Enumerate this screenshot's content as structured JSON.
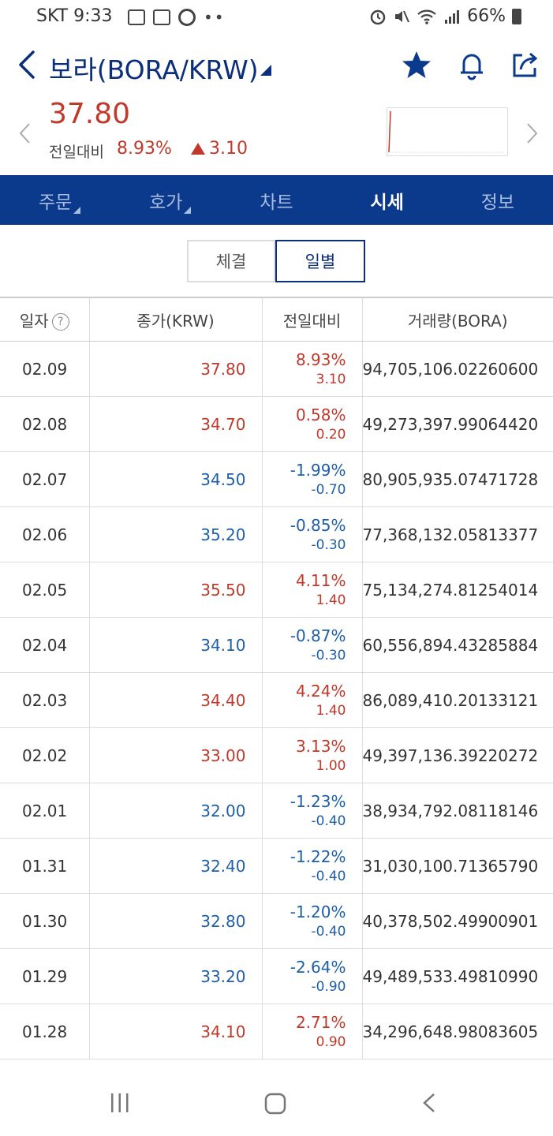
{
  "status": {
    "time": "SKT 9:33",
    "battery": "66%"
  },
  "header": {
    "title": "보라(BORA/KRW)"
  },
  "quote": {
    "price": "37.80",
    "compare_label": "전일대비",
    "change_pct": "8.93%",
    "change_abs": "3.10"
  },
  "tabs": [
    "주문",
    "호가",
    "차트",
    "시세",
    "정보"
  ],
  "segments": [
    "체결",
    "일별"
  ],
  "table": {
    "headers": [
      "일자",
      "종가(KRW)",
      "전일대비",
      "거래량(BORA)"
    ],
    "rows": [
      {
        "date": "02.09",
        "close": "37.80",
        "pct": "8.93%",
        "abs": "3.10",
        "vol": "94,705,106.02260600",
        "dir": "up"
      },
      {
        "date": "02.08",
        "close": "34.70",
        "pct": "0.58%",
        "abs": "0.20",
        "vol": "49,273,397.99064420",
        "dir": "up"
      },
      {
        "date": "02.07",
        "close": "34.50",
        "pct": "-1.99%",
        "abs": "-0.70",
        "vol": "80,905,935.07471728",
        "dir": "down"
      },
      {
        "date": "02.06",
        "close": "35.20",
        "pct": "-0.85%",
        "abs": "-0.30",
        "vol": "77,368,132.05813377",
        "dir": "down"
      },
      {
        "date": "02.05",
        "close": "35.50",
        "pct": "4.11%",
        "abs": "1.40",
        "vol": "75,134,274.81254014",
        "dir": "up"
      },
      {
        "date": "02.04",
        "close": "34.10",
        "pct": "-0.87%",
        "abs": "-0.30",
        "vol": "60,556,894.43285884",
        "dir": "down"
      },
      {
        "date": "02.03",
        "close": "34.40",
        "pct": "4.24%",
        "abs": "1.40",
        "vol": "86,089,410.20133121",
        "dir": "up"
      },
      {
        "date": "02.02",
        "close": "33.00",
        "pct": "3.13%",
        "abs": "1.00",
        "vol": "49,397,136.39220272",
        "dir": "up"
      },
      {
        "date": "02.01",
        "close": "32.00",
        "pct": "-1.23%",
        "abs": "-0.40",
        "vol": "38,934,792.08118146",
        "dir": "down"
      },
      {
        "date": "01.31",
        "close": "32.40",
        "pct": "-1.22%",
        "abs": "-0.40",
        "vol": "31,030,100.71365790",
        "dir": "down"
      },
      {
        "date": "01.30",
        "close": "32.80",
        "pct": "-1.20%",
        "abs": "-0.40",
        "vol": "40,378,502.49900901",
        "dir": "down"
      },
      {
        "date": "01.29",
        "close": "33.20",
        "pct": "-2.64%",
        "abs": "-0.90",
        "vol": "49,489,533.49810990",
        "dir": "down"
      },
      {
        "date": "01.28",
        "close": "34.10",
        "pct": "2.71%",
        "abs": "0.90",
        "vol": "34,296,648.98083605",
        "dir": "up"
      }
    ]
  },
  "colors": {
    "brand_blue": "#0b3a8c",
    "up_red": "#c0392b",
    "down_blue": "#1f5fa8"
  },
  "icons": {
    "back": "back-chevron-icon",
    "favorite": "star-icon",
    "alarm": "bell-icon",
    "share": "share-icon"
  }
}
